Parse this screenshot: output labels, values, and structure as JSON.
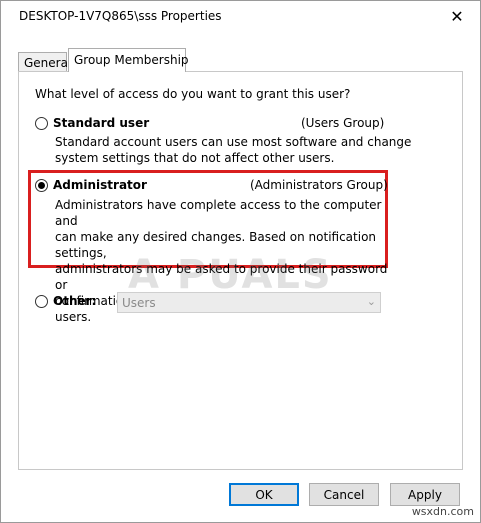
{
  "window": {
    "title": "DESKTOP-1V7Q865\\sss Properties",
    "close_glyph": "✕"
  },
  "tabs": [
    {
      "label": "General"
    },
    {
      "label": "Group Membership"
    }
  ],
  "panel": {
    "question": "What level of access do you want to grant this user?",
    "options": {
      "standard": {
        "label": "Standard user",
        "group": "(Users Group)",
        "description_lines": [
          "Standard account users can use most software and change",
          "system settings that do not affect other users."
        ],
        "selected": false
      },
      "administrator": {
        "label": "Administrator",
        "group": "(Administrators Group)",
        "description_lines": [
          "Administrators have complete access to the computer and",
          "can make any desired changes. Based on notification settings,",
          "administrators may be asked to provide their password or",
          "confirmation before making changes that affect other users."
        ],
        "selected": true
      },
      "other": {
        "label": "Other:",
        "select_value": "Users",
        "selected": false
      }
    }
  },
  "buttons": {
    "ok": "OK",
    "cancel": "Cancel",
    "apply": "Apply"
  },
  "watermark": "A PUALS",
  "corner_mark": "wsxdn.com",
  "colors": {
    "highlight_border": "#d91f1f",
    "default_button_border": "#0078d7"
  }
}
